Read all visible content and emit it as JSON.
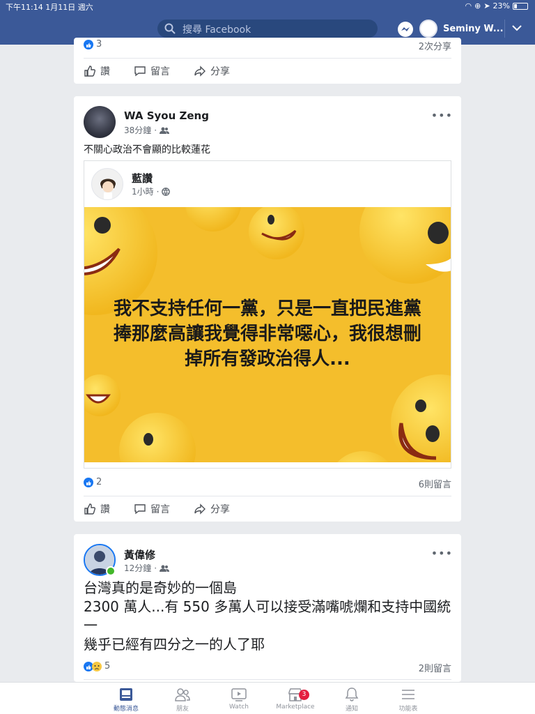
{
  "status": {
    "time": "下午11:14",
    "date": "1月11日 週六",
    "battery": "23%"
  },
  "header": {
    "search_placeholder": "搜尋 Facebook",
    "user_name": "Seminy W..."
  },
  "prev_post": {
    "reactions_count": "3",
    "shares": "2次分享",
    "like": "讚",
    "comment": "留言",
    "share": "分享"
  },
  "post1": {
    "author": "WA Syou Zeng",
    "time": "38分鐘",
    "text": "不關心政治不會顯的比較蓮花",
    "shared_author": "藍讚",
    "shared_time": "1小時",
    "image_text": "我不支持任何一黨，只是一直把民進黨捧那麼高讓我覺得非常噁心，我很想刪掉所有發政治得人...",
    "reactions_count": "2",
    "comments": "6則留言",
    "like": "讚",
    "comment": "留言",
    "share": "分享"
  },
  "post2": {
    "author": "黃偉修",
    "time": "12分鐘",
    "text_lines": [
      "台灣真的是奇妙的一個島",
      "2300 萬人...有 550 多萬人可以接受滿嘴唬爛和支持中國統一",
      "幾乎已經有四分之一的人了耶"
    ],
    "reactions_count": "5",
    "comments": "2則留言"
  },
  "nav": [
    {
      "label": "動態消息",
      "icon": "news-feed-icon"
    },
    {
      "label": "朋友",
      "icon": "friends-icon"
    },
    {
      "label": "Watch",
      "icon": "watch-icon"
    },
    {
      "label": "Marketplace",
      "icon": "marketplace-icon",
      "badge": "3"
    },
    {
      "label": "通知",
      "icon": "bell-icon"
    },
    {
      "label": "功能表",
      "icon": "menu-icon"
    }
  ],
  "colors": {
    "brand": "#3b5998",
    "image_bg": "#f4be2c",
    "like_blue": "#1877f2"
  }
}
